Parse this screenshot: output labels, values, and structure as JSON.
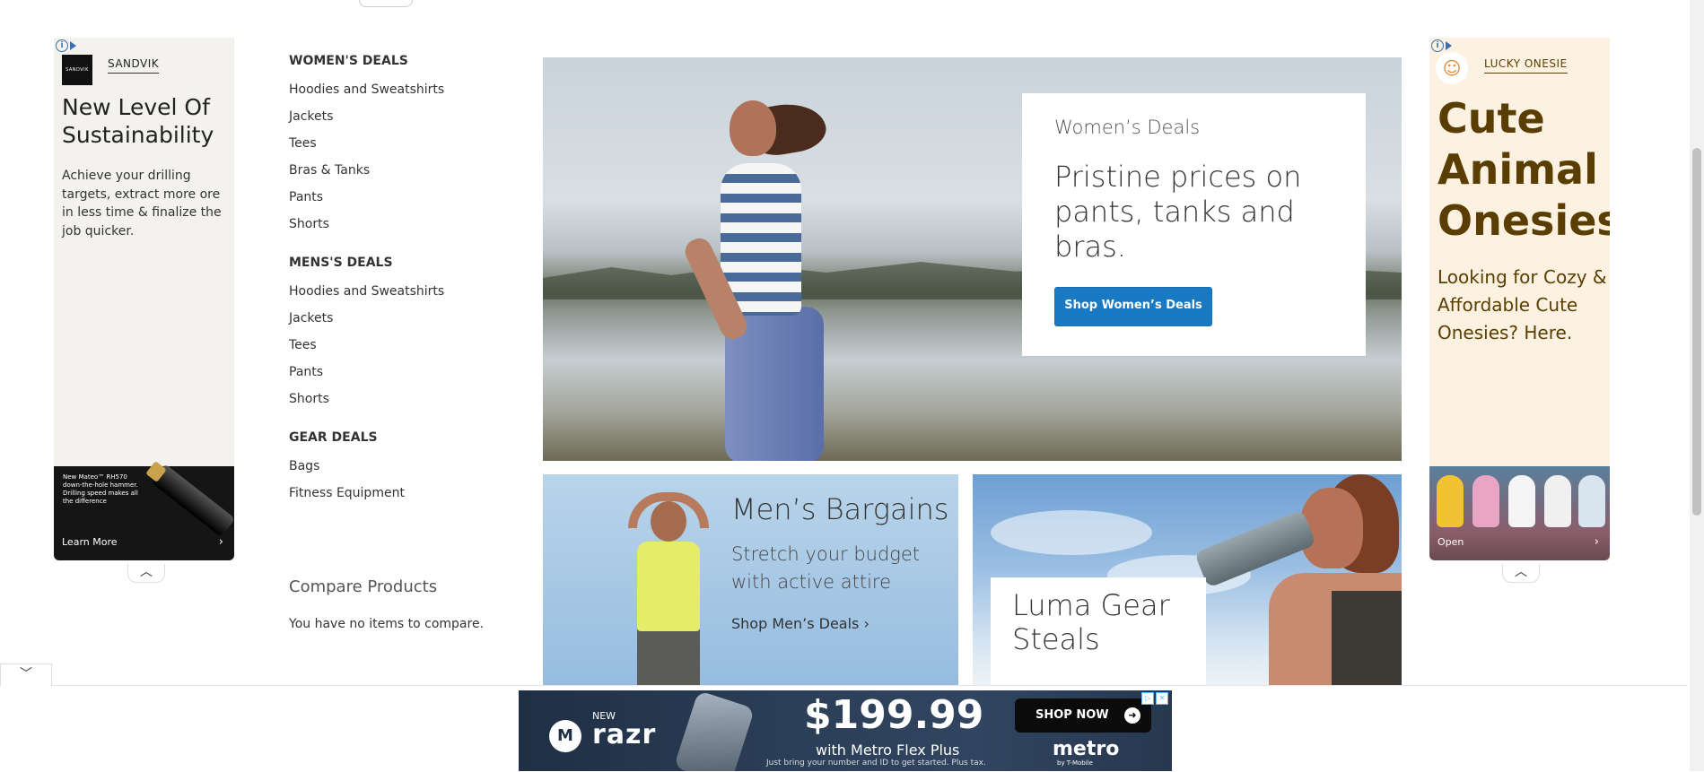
{
  "left_ad": {
    "brand": "SANDVIK",
    "logo_text": "SANDVIK",
    "headline": "New Level Of Sustainability",
    "body": "Achieve your drilling targets, extract more ore in less time & finalize the job quicker.",
    "image_text": "New Mateo™ RH570 down-the-hole hammer. Drilling speed makes all the difference",
    "cta": "Learn More"
  },
  "sidebar": {
    "sections": [
      {
        "title": "WOMEN'S DEALS",
        "items": [
          "Hoodies and Sweatshirts",
          "Jackets",
          "Tees",
          "Bras & Tanks",
          "Pants",
          "Shorts"
        ]
      },
      {
        "title": "MENS'S DEALS",
        "items": [
          "Hoodies and Sweatshirts",
          "Jackets",
          "Tees",
          "Pants",
          "Shorts"
        ]
      },
      {
        "title": "GEAR DEALS",
        "items": [
          "Bags",
          "Fitness Equipment"
        ]
      }
    ],
    "compare_title": "Compare Products",
    "compare_empty": "You have no items to compare."
  },
  "hero": {
    "kicker": "Women’s Deals",
    "headline": "Pristine prices on pants, tanks and bras.",
    "button": "Shop Women’s Deals"
  },
  "men_tile": {
    "title": "Men’s Bargains",
    "subtitle": "Stretch your budget with active attire",
    "link": "Shop Men’s Deals ›"
  },
  "gear_tile": {
    "title": "Luma Gear Steals"
  },
  "right_ad": {
    "brand": "LUCKY ONESIE",
    "headline": "Cute Animal Onesies",
    "body": "Looking for Cozy & Affordable Cute Onesies? Here.",
    "cta": "Open"
  },
  "bottom_ad": {
    "new": "NEW",
    "product": "razr",
    "price": "$199.99",
    "plan": "with Metro Flex Plus",
    "fine_print": "Just bring your number and ID to get started. Plus tax.",
    "cta": "SHOP NOW",
    "brand": "metro",
    "sub_brand": "by T-Mobile"
  },
  "colors": {
    "accent": "#1979c3",
    "right_ad_bg": "#fdf2e1",
    "right_ad_text": "#5a3d00",
    "left_ad_bg": "#f3f2ef"
  }
}
